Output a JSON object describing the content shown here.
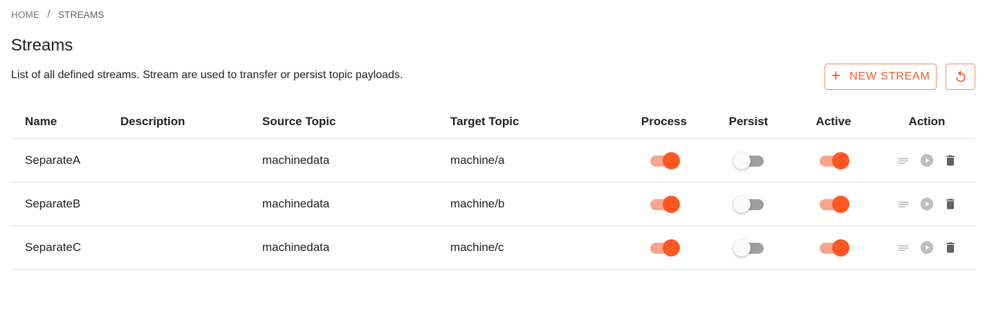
{
  "breadcrumb": {
    "home": "HOME",
    "separator": "/",
    "current": "STREAMS"
  },
  "page": {
    "title": "Streams",
    "description": "List of all defined streams. Stream are used to transfer or persist topic payloads."
  },
  "toolbar": {
    "new_stream_label": "NEW STREAM",
    "new_stream_icon": "plus-icon",
    "refresh_icon": "refresh-icon"
  },
  "table": {
    "headers": {
      "name": "Name",
      "description": "Description",
      "source_topic": "Source Topic",
      "target_topic": "Target Topic",
      "process": "Process",
      "persist": "Persist",
      "active": "Active",
      "action": "Action"
    },
    "rows": [
      {
        "name": "SeparateA",
        "description": "",
        "source_topic": "machinedata",
        "target_topic": "machine/a",
        "process": true,
        "persist": false,
        "active": true
      },
      {
        "name": "SeparateB",
        "description": "",
        "source_topic": "machinedata",
        "target_topic": "machine/b",
        "process": true,
        "persist": false,
        "active": true
      },
      {
        "name": "SeparateC",
        "description": "",
        "source_topic": "machinedata",
        "target_topic": "machine/c",
        "process": true,
        "persist": false,
        "active": true
      }
    ]
  },
  "colors": {
    "accent": "#ff5722",
    "accent_light": "#f7a68b",
    "switch_off_track": "#9e9e9e",
    "divider": "#e0e0e0",
    "action_icon_disabled": "#bdbdbd",
    "delete_icon": "#616161"
  }
}
